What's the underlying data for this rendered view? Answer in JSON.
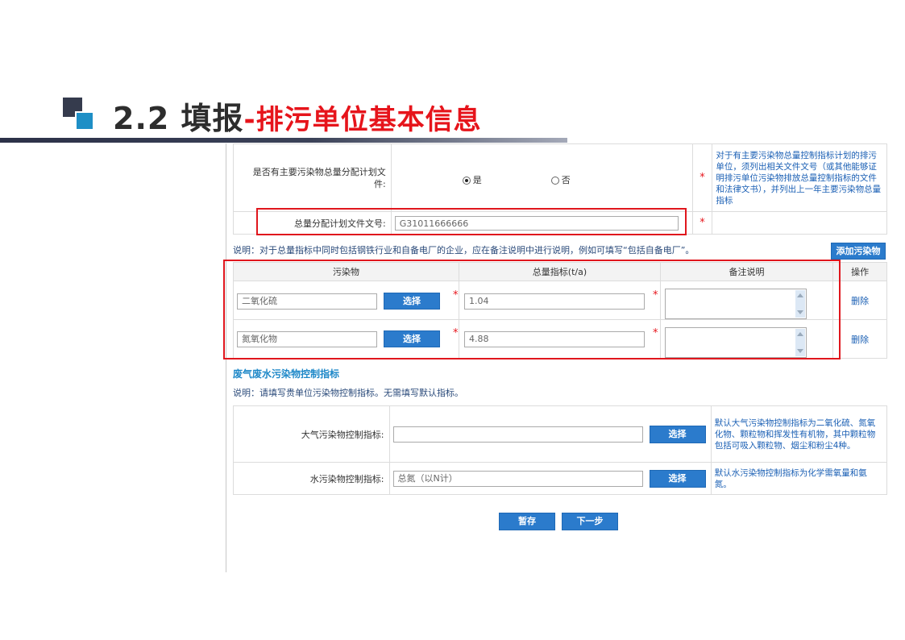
{
  "slide": {
    "title_main": "2.2  填报",
    "title_sub": "-排污单位基本信息"
  },
  "plan": {
    "question": "是否有主要污染物总量分配计划文件:",
    "radio_yes": "是",
    "radio_no": "否",
    "selected": "是",
    "note": "对于有主要污染物总量控制指标计划的排污单位，须列出相关文件文号（或其他能够证明排污单位污染物排放总量控制指标的文件和法律文书），并列出上一年主要污染物总量指标",
    "file_no_label": "总量分配计划文件文号:",
    "file_no_value": "G31011666666",
    "required": "*"
  },
  "explain1": "说明：对于总量指标中同时包括钢铁行业和自备电厂的企业，应在备注说明中进行说明，例如可填写“包括自备电厂”。",
  "add_pollutant_button": "添加污染物",
  "pollutant_table": {
    "headers": [
      "污染物",
      "总量指标(t/a)",
      "备注说明",
      "操作"
    ],
    "rows": [
      {
        "name": "二氧化硫",
        "choose": "选择",
        "total": "1.04",
        "remark": "",
        "action": "删除"
      },
      {
        "name": "氮氧化物",
        "choose": "选择",
        "total": "4.88",
        "remark": "",
        "action": "删除"
      }
    ]
  },
  "control": {
    "section_title": "废气废水污染物控制指标",
    "explain": "说明：请填写贵单位污染物控制指标。无需填写默认指标。",
    "air_label": "大气污染物控制指标:",
    "air_value": "",
    "air_choose": "选择",
    "air_note": "默认大气污染物控制指标为二氧化硫、氮氧化物、颗粒物和挥发性有机物，其中颗粒物包括可吸入颗粒物、烟尘和粉尘4种。",
    "water_label": "水污染物控制指标:",
    "water_value": "总氮（以N计）",
    "water_choose": "选择",
    "water_note": "默认水污染物控制指标为化学需氧量和氨氮。"
  },
  "footer": {
    "save": "暂存",
    "next": "下一步"
  },
  "colors": {
    "accent": "#e6141b",
    "button": "#2b7bcc",
    "note_text": "#1a5fb4"
  }
}
